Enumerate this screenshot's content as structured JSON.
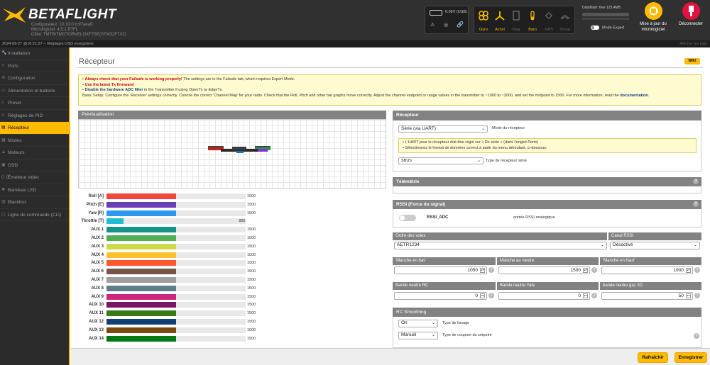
{
  "header": {
    "logo_text": "BETAFLIGHT",
    "configurator": "Configurateur: 10.10.0 (c97aeaf)",
    "firmware": "Micrologiciel: 4.5.1 BTFL",
    "target": "Cible: TMTR/TMOTORVELOXF7SE(STM32F7X2)",
    "battery": "0.05V (USB)",
    "sensors": [
      "Gyro",
      "Accel",
      "Mag",
      "Baro",
      "GPS",
      "Sonar"
    ],
    "dataflash": "Dataflash: free 125.4MB",
    "expert_mode": "Mode Expert",
    "update_label": "Mise à jour du micrologiciel",
    "disconnect_label": "Déconnecter",
    "colors": {
      "accent": "#ffbb00",
      "disconnect": "#e2123f"
    }
  },
  "status": {
    "message": "2024-09-27 @16:21:57 -- Réglages OSD enregistrés",
    "show_logs": "Afficher les logs"
  },
  "sidebar": {
    "items": [
      {
        "label": "Installation",
        "icon": "wrench-icon"
      },
      {
        "label": "Ports",
        "icon": "plug-icon"
      },
      {
        "label": "Configuration",
        "icon": "gear-icon"
      },
      {
        "label": "Alimentation et batterie",
        "icon": "battery-icon"
      },
      {
        "label": "Preset",
        "icon": "search-icon"
      },
      {
        "label": "Réglages de PID",
        "icon": "sliders-icon"
      },
      {
        "label": "Récepteur",
        "icon": "receiver-icon",
        "active": true
      },
      {
        "label": "Modes",
        "icon": "modes-icon"
      },
      {
        "label": "Moteurs",
        "icon": "motor-icon"
      },
      {
        "label": "OSD",
        "icon": "osd-icon"
      },
      {
        "label": "Émetteur vidéo",
        "icon": "vtx-icon"
      },
      {
        "label": "Bandeau LED",
        "icon": "led-icon"
      },
      {
        "label": "Blackbox",
        "icon": "blackbox-icon"
      },
      {
        "label": "Ligne de commande (CLI)",
        "icon": "cli-icon"
      }
    ]
  },
  "page": {
    "title": "Récepteur",
    "wiki": "WIKI",
    "notice": {
      "line1_bold": "Always check that your Failsafe is working properly!",
      "line1_rest": " The settings are in the Failsafe tab, which requires Expert Mode.",
      "line2_bold": "Use the latest Tx firmware!",
      "line3_bold": "Disable the hardware ADC filter",
      "line3_rest": " in the Transmitter if using OpenTx or EdgeTx.",
      "line4": "Basic Setup: Configure the 'Receiver' settings correctly. Choose the correct 'Channel Map' for your radio. Check that the Roll, Pitch and other bar graphs move correctly. Adjust the channel endpoint or range values in the transmitter to ~1000 to ~2000, and set the midpoint to 1500. For more information, read the",
      "line4_link": "documentation",
      "line4_end": "."
    },
    "preview_title": "Prévisualisation",
    "channels": [
      {
        "name": "Roll [A]",
        "value": "1500",
        "fraction": 0.5,
        "color": "#f1453d"
      },
      {
        "name": "Pitch [E]",
        "value": "1500",
        "fraction": 0.5,
        "color": "#673fb4"
      },
      {
        "name": "Yaw [R]",
        "value": "1500",
        "fraction": 0.5,
        "color": "#2b98f0"
      },
      {
        "name": "Throttle [T]",
        "value": "885",
        "fraction": 0.0,
        "color": "#1fbcd2"
      },
      {
        "name": "AUX 1",
        "value": "1500",
        "fraction": 0.5,
        "color": "#159588"
      },
      {
        "name": "AUX 2",
        "value": "1500",
        "fraction": 0.5,
        "color": "#50ae55"
      },
      {
        "name": "AUX 3",
        "value": "1500",
        "fraction": 0.5,
        "color": "#cdda49"
      },
      {
        "name": "AUX 4",
        "value": "1500",
        "fraction": 0.5,
        "color": "#fdc02f"
      },
      {
        "name": "AUX 5",
        "value": "1500",
        "fraction": 0.5,
        "color": "#fc5830"
      },
      {
        "name": "AUX 6",
        "value": "1500",
        "fraction": 0.5,
        "color": "#785549"
      },
      {
        "name": "AUX 7",
        "value": "1500",
        "fraction": 0.5,
        "color": "#9e9e9e"
      },
      {
        "name": "AUX 8",
        "value": "1500",
        "fraction": 0.5,
        "color": "#617d8a"
      },
      {
        "name": "AUX 9",
        "value": "1500",
        "fraction": 0.5,
        "color": "#cf267d"
      },
      {
        "name": "AUX 10",
        "value": "1500",
        "fraction": 0.5,
        "color": "#7a1464"
      },
      {
        "name": "AUX 11",
        "value": "1500",
        "fraction": 0.5,
        "color": "#3a7a14"
      },
      {
        "name": "AUX 12",
        "value": "1500",
        "fraction": 0.5,
        "color": "#14407a"
      },
      {
        "name": "AUX 13",
        "value": "1500",
        "fraction": 0.5,
        "color": "#7a4a14"
      },
      {
        "name": "AUX 14",
        "value": "1500",
        "fraction": 0.5,
        "color": "#027a14"
      }
    ],
    "receiver": {
      "title": "Récepteur",
      "mode_value": "Série (via UART)",
      "mode_label": "Mode du récepteur",
      "info1": "• L'UART pour le récepteur doit être réglé sur « Rx série » (dans l'onglet ",
      "info1_italic": "Ports",
      "info1_end": ")",
      "info2": "• Sélectionnez le format de données correct à partir du menu déroulant, ci-dessous:",
      "type_value": "SBUS",
      "type_label": "Type de récepteur série"
    },
    "telemetry_title": "Télémétrie",
    "rssi": {
      "title": "RSSI (Force du signal)",
      "adc_label": "RSSI_ADC",
      "adc_desc": "entrée RSSI analogique"
    },
    "channel_map": {
      "label": "Ordre des voies",
      "value": "AETR1234"
    },
    "rssi_channel": {
      "label": "Canal RSSI",
      "value": "Désactivé"
    },
    "stick": {
      "low_label": "'Manche en bas'",
      "low_value": "1050",
      "center_label": "Manche au neutre",
      "center_value": "1500",
      "high_label": "'Manche en haut'",
      "high_value": "1900"
    },
    "deadband": {
      "rc_label": "Bande neutre RC",
      "rc_value": "0",
      "yaw_label": "Bande neutre Yaw",
      "yaw_value": "0",
      "throttle3d_label": "bande neutre gaz 3D",
      "throttle3d_value": "50"
    },
    "smoothing": {
      "title": "RC Smoothing",
      "type_value": "On",
      "type_label": "Type de lissage",
      "cutoff_value": "Manuel",
      "cutoff_label": "Type de coupure du setpoint"
    }
  },
  "footer": {
    "refresh": "Rafraîchir",
    "save": "Enregistrer"
  }
}
